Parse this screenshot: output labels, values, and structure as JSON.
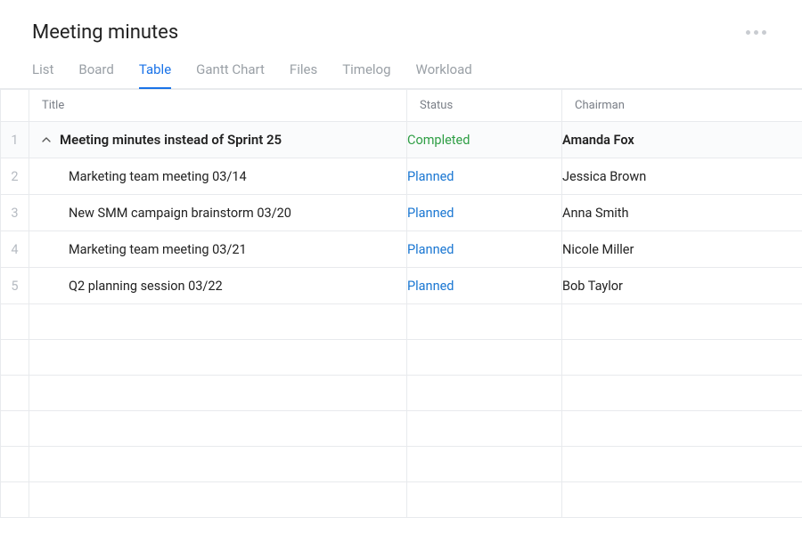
{
  "header": {
    "title": "Meeting minutes"
  },
  "tabs": [
    {
      "label": "List",
      "active": false
    },
    {
      "label": "Board",
      "active": false
    },
    {
      "label": "Table",
      "active": true
    },
    {
      "label": "Gantt Chart",
      "active": false
    },
    {
      "label": "Files",
      "active": false
    },
    {
      "label": "Timelog",
      "active": false
    },
    {
      "label": "Workload",
      "active": false
    }
  ],
  "columns": {
    "title": "Title",
    "status": "Status",
    "chairman": "Chairman"
  },
  "status_labels": {
    "completed": "Completed",
    "planned": "Planned"
  },
  "rows": [
    {
      "num": "1",
      "title": "Meeting minutes instead of Sprint 25",
      "status_key": "completed",
      "chairman": "Amanda Fox",
      "parent": true
    },
    {
      "num": "2",
      "title": "Marketing team meeting 03/14",
      "status_key": "planned",
      "chairman": "Jessica Brown",
      "parent": false
    },
    {
      "num": "3",
      "title": "New SMM campaign brainstorm 03/20",
      "status_key": "planned",
      "chairman": "Anna Smith",
      "parent": false
    },
    {
      "num": "4",
      "title": "Marketing team meeting 03/21",
      "status_key": "planned",
      "chairman": "Nicole Miller",
      "parent": false
    },
    {
      "num": "5",
      "title": "Q2 planning session 03/22",
      "status_key": "planned",
      "chairman": "Bob Taylor",
      "parent": false
    }
  ]
}
